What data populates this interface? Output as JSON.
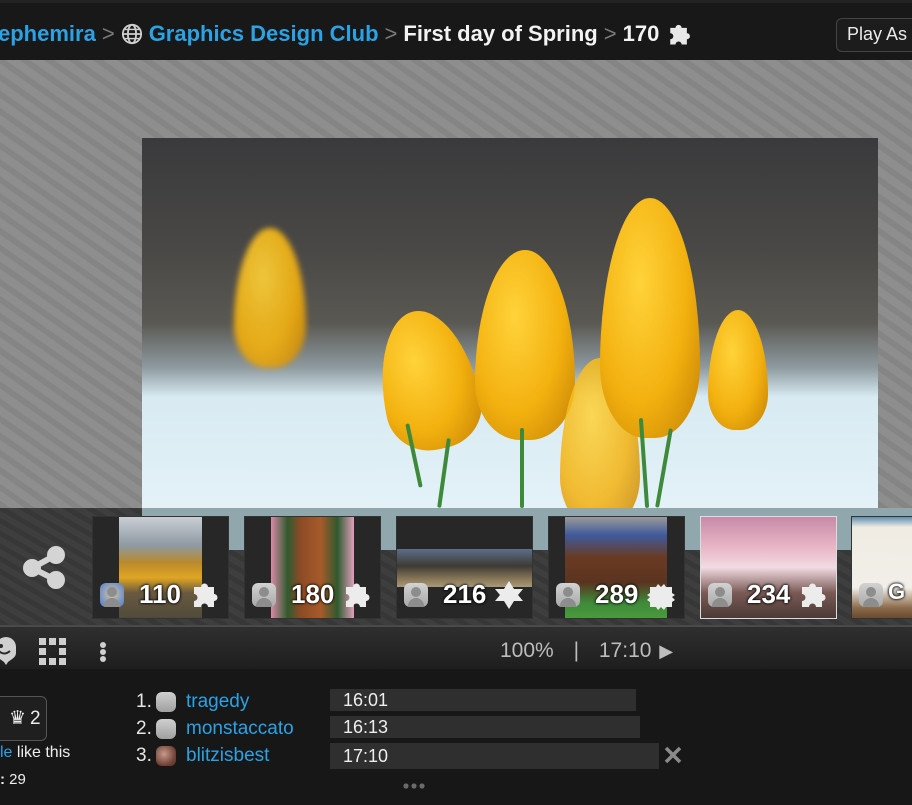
{
  "header": {
    "breadcrumbs": [
      {
        "label": "ephemira",
        "type": "link"
      },
      {
        "label": "Graphics Design Club",
        "type": "link",
        "icon": "globe-icon"
      },
      {
        "label": "First day of Spring",
        "type": "current"
      },
      {
        "label": "170",
        "type": "current",
        "icon": "puzzle-piece-icon"
      }
    ],
    "play_as_label": "Play As"
  },
  "stage": {
    "image_subject": "Yellow crocus buds with water droplets in snow"
  },
  "related_puzzles": [
    {
      "pieces": "110",
      "subject": "Autumn valley with bridge and granite dome",
      "avatar": "user-photo",
      "piece_icon": "puzzle-piece-icon"
    },
    {
      "pieces": "180",
      "subject": "Horse with flower garland",
      "avatar": "default",
      "piece_icon": "puzzle-piece-icon"
    },
    {
      "pieces": "216",
      "subject": "Harness racing",
      "avatar": "default",
      "piece_icon": "star-piece-icon"
    },
    {
      "pieces": "289",
      "subject": "Horse race",
      "avatar": "default",
      "piece_icon": "jagged-piece-icon"
    },
    {
      "pieces": "234",
      "subject": "Winged horse fantasy",
      "avatar": "default",
      "piece_icon": "puzzle-piece-icon"
    },
    {
      "pieces": "",
      "subject": "Graphics sign",
      "avatar": "default",
      "partial_label": "G"
    }
  ],
  "toolbar": {
    "zoom": "100%",
    "separator": "|",
    "time": "17:10"
  },
  "social": {
    "like_count": "2",
    "likes_text_link": "le",
    "likes_text_rest": " like this",
    "stat_label": ":",
    "stat_value": "29"
  },
  "leaderboard": [
    {
      "rank": "1.",
      "name": "tragedy",
      "time": "16:01"
    },
    {
      "rank": "2.",
      "name": "monstaccato",
      "time": "16:13"
    },
    {
      "rank": "3.",
      "name": "blitzisbest",
      "time": "17:10",
      "removable": true
    }
  ],
  "colors": {
    "link": "#29a3e6",
    "background": "#171717",
    "bar": "#2f2f2f"
  }
}
